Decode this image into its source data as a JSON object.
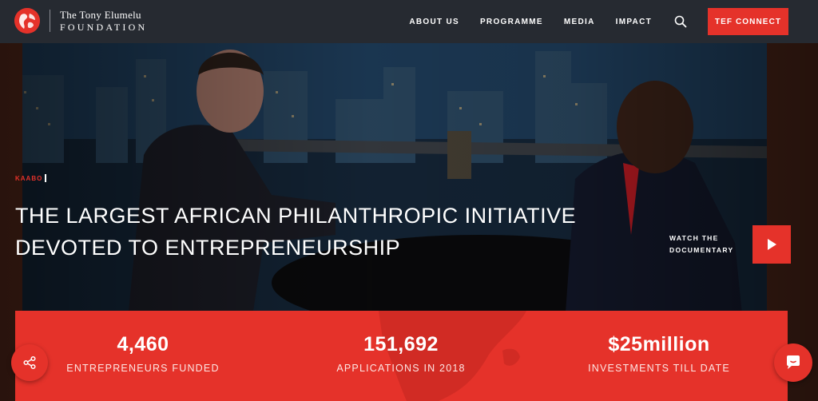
{
  "colors": {
    "accent": "#e5322a",
    "nav_bg": "#262a31"
  },
  "logo": {
    "line1": "The Tony Elumelu",
    "line2": "FOUNDATION"
  },
  "nav": {
    "items": [
      {
        "label": "ABOUT US"
      },
      {
        "label": "PROGRAMME"
      },
      {
        "label": "MEDIA"
      },
      {
        "label": "IMPACT"
      }
    ],
    "search_icon": "search-icon",
    "cta_label": "TEF CONNECT"
  },
  "hero": {
    "tag": "KAABO",
    "headline_line1": "THE LARGEST AFRICAN PHILANTHROPIC INITIATIVE",
    "headline_line2": "DEVOTED TO ENTREPRENEURSHIP",
    "watch_line1": "WATCH THE",
    "watch_line2": "DOCUMENTARY",
    "play_icon": "play-icon"
  },
  "stats": [
    {
      "value": "4,460",
      "label": "ENTREPRENEURS FUNDED"
    },
    {
      "value": "151,692",
      "label": "APPLICATIONS IN 2018"
    },
    {
      "value": "$25million",
      "label": "INVESTMENTS TILL DATE"
    }
  ],
  "floating": {
    "share_icon": "share-icon",
    "chat_icon": "chat-icon"
  }
}
